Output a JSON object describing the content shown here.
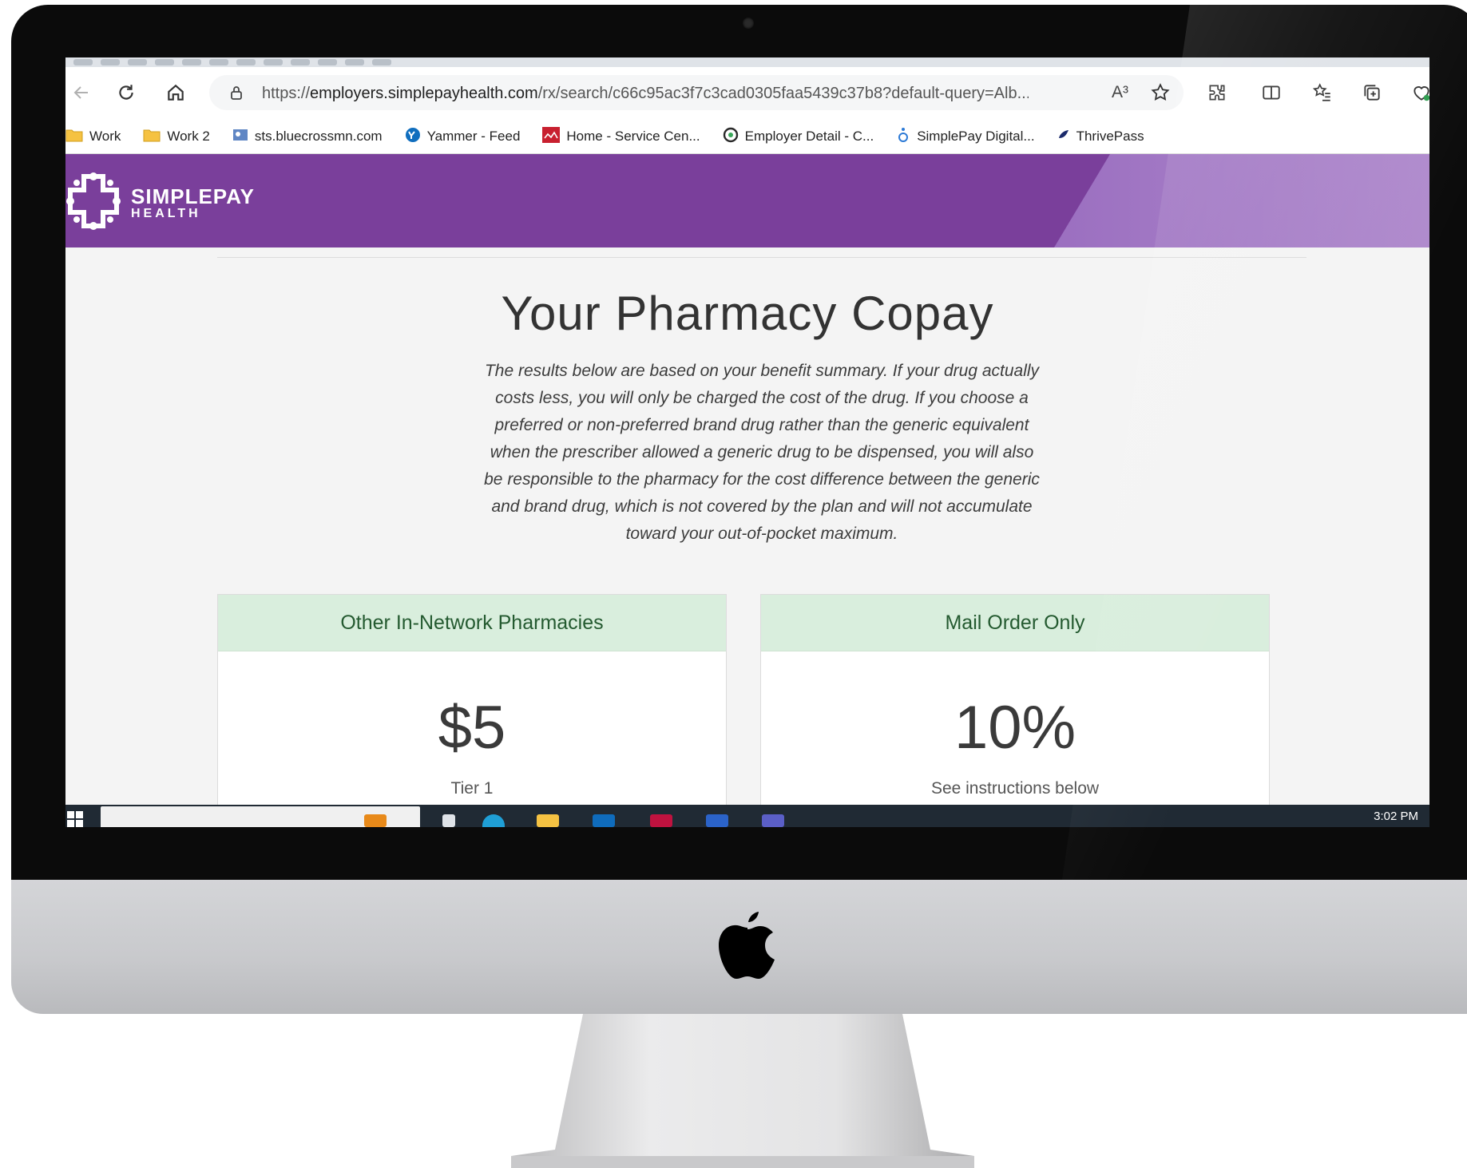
{
  "browser": {
    "url_prefix": "https://",
    "url_host": "employers.simplepayhealth.com",
    "url_path": "/rx/search/c66c95ac3f7c3cad0305faa5439c37b8?default-query=Alb...",
    "read_aloud_label": "A³"
  },
  "bookmarks": [
    {
      "label": "Work",
      "icon": "folder-icon"
    },
    {
      "label": "Work 2",
      "icon": "folder-icon"
    },
    {
      "label": "sts.bluecrossmn.com",
      "icon": "site-icon"
    },
    {
      "label": "Yammer - Feed",
      "icon": "yammer-icon"
    },
    {
      "label": "Home - Service Cen...",
      "icon": "service-icon"
    },
    {
      "label": "Employer Detail - C...",
      "icon": "c-icon"
    },
    {
      "label": "SimplePay Digital...",
      "icon": "accessibility-icon"
    },
    {
      "label": "ThrivePass",
      "icon": "thrivepass-icon"
    }
  ],
  "site": {
    "brand_name": "SIMPLEPAY",
    "brand_sub": "HEALTH",
    "brand_color": "#7a3f9b"
  },
  "page": {
    "title": "Your Pharmacy Copay",
    "intro": "The results below are based on your benefit summary. If your drug actually costs less, you will only be charged the cost of the drug. If you choose a preferred or non-preferred brand drug rather than the generic equivalent when the prescriber allowed a generic drug to be dispensed, you will also be responsible to the pharmacy for the cost difference between the generic and brand drug, which is not covered by the plan and will not accumulate toward your out-of-pocket maximum."
  },
  "cards": [
    {
      "heading": "Other In-Network Pharmacies",
      "value": "$5",
      "subtext": "Tier 1"
    },
    {
      "heading": "Mail Order Only",
      "value": "10%",
      "subtext": "See instructions below"
    }
  ],
  "taskbar": {
    "clock": "3:02 PM"
  }
}
